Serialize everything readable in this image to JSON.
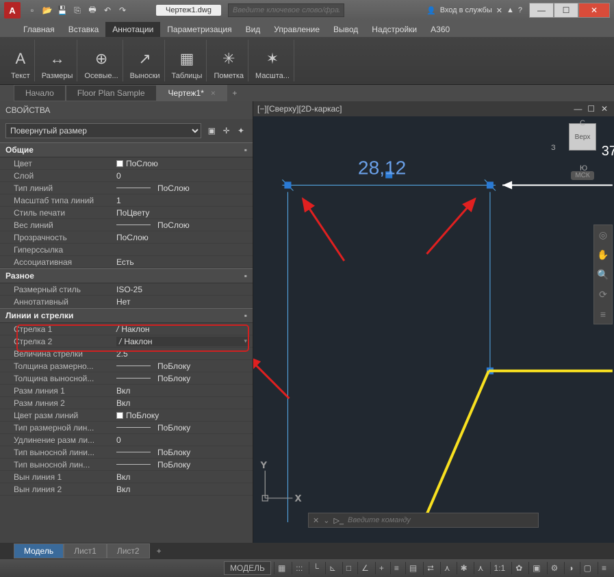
{
  "title": "Чертеж1.dwg",
  "search_placeholder": "Введите ключевое слово/фразу",
  "signin": "Вход в службы",
  "menu": [
    "Главная",
    "Вставка",
    "Аннотации",
    "Параметризация",
    "Вид",
    "Управление",
    "Вывод",
    "Надстройки",
    "A360"
  ],
  "menu_active": 2,
  "ribbon_groups": [
    {
      "icon": "A",
      "label": "Текст"
    },
    {
      "icon": "↔",
      "label": "Размеры"
    },
    {
      "icon": "⊕",
      "label": "Осевые..."
    },
    {
      "icon": "↗",
      "label": "Выноски"
    },
    {
      "icon": "▦",
      "label": "Таблицы"
    },
    {
      "icon": "✳",
      "label": "Пометка"
    },
    {
      "icon": "✶",
      "label": "Масшта..."
    }
  ],
  "file_tabs": [
    {
      "label": "Начало",
      "active": false
    },
    {
      "label": "Floor Plan Sample",
      "active": false
    },
    {
      "label": "Чертеж1*",
      "active": true
    }
  ],
  "props_title": "СВОЙСТВА",
  "selection_type": "Повернутый размер",
  "sections": {
    "general": {
      "title": "Общие",
      "rows": [
        {
          "k": "Цвет",
          "v": "ПоСлою",
          "swatch": true
        },
        {
          "k": "Слой",
          "v": "0"
        },
        {
          "k": "Тип линий",
          "v": "ПоСлою",
          "line": true
        },
        {
          "k": "Масштаб типа линий",
          "v": "1"
        },
        {
          "k": "Стиль печати",
          "v": "ПоЦвету"
        },
        {
          "k": "Вес линий",
          "v": "ПоСлою",
          "line": true
        },
        {
          "k": "Прозрачность",
          "v": "ПоСлою"
        },
        {
          "k": "Гиперссылка",
          "v": ""
        },
        {
          "k": "Ассоциативная",
          "v": "Есть"
        }
      ]
    },
    "misc": {
      "title": "Разное",
      "rows": [
        {
          "k": "Размерный стиль",
          "v": "ISO-25"
        },
        {
          "k": "Аннотативный",
          "v": "Нет"
        }
      ]
    },
    "lines": {
      "title": "Линии и стрелки",
      "rows": [
        {
          "k": "Стрелка 1",
          "v": "Наклон",
          "slash": true,
          "hl": true
        },
        {
          "k": "Стрелка 2",
          "v": "Наклон",
          "slash": true,
          "hl": true,
          "sel": true
        },
        {
          "k": "Величина стрелки",
          "v": "2.5"
        },
        {
          "k": "Толщина размерно...",
          "v": "ПоБлоку",
          "line": true
        },
        {
          "k": "Толщина выносной...",
          "v": "ПоБлоку",
          "line": true
        },
        {
          "k": "Разм линия 1",
          "v": "Вкл"
        },
        {
          "k": "Разм линия 2",
          "v": "Вкл"
        },
        {
          "k": "Цвет разм линий",
          "v": "ПоБлоку",
          "swatch": true
        },
        {
          "k": "Тип размерной лин...",
          "v": "ПоБлоку",
          "line": true
        },
        {
          "k": "Удлинение разм ли...",
          "v": "0"
        },
        {
          "k": "Тип выносной лини...",
          "v": "ПоБлоку",
          "line": true
        },
        {
          "k": "Тип выносной лин...",
          "v": "ПоБлоку",
          "line": true
        },
        {
          "k": "Вын линия 1",
          "v": "Вкл"
        },
        {
          "k": "Вын линия 2",
          "v": "Вкл"
        }
      ]
    }
  },
  "viewport_label": "[−][Сверху][2D-каркас]",
  "dim_value": "28,12",
  "viewcube": {
    "face": "Верх",
    "n": "С",
    "s": "Ю",
    "w": "З",
    "e": "37",
    "sys": "МСК"
  },
  "cmd_placeholder": "Введите команду",
  "model_tabs": [
    {
      "label": "Модель",
      "active": true
    },
    {
      "label": "Лист1",
      "active": false
    },
    {
      "label": "Лист2",
      "active": false
    }
  ],
  "status": {
    "model": "МОДЕЛЬ",
    "scale": "1:1"
  }
}
